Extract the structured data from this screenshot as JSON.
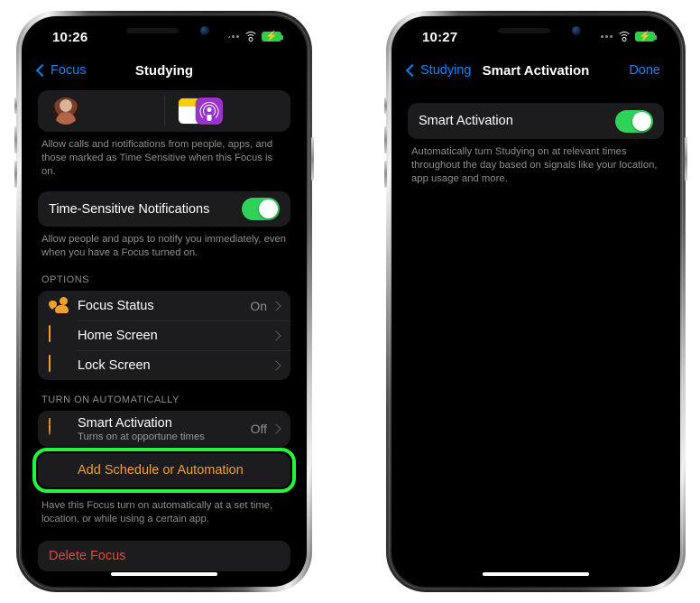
{
  "left_phone": {
    "status_bar": {
      "time": "10:26",
      "wifi_icon": "wifi-icon",
      "battery_icon": "battery-charging-icon",
      "signal_icon": "signal-dots-icon"
    },
    "nav": {
      "back_label": "Focus",
      "title": "Studying",
      "back_icon": "chevron-left-icon"
    },
    "allowed_apps": {
      "avatar_name": "person-avatar",
      "app_icons": [
        "notes-app-icon",
        "podcasts-app-icon"
      ]
    },
    "allowed_footnote": "Allow calls and notifications from people, apps, and those marked as Time Sensitive when this Focus is on.",
    "time_sensitive": {
      "label": "Time-Sensitive Notifications",
      "toggle_state": "on"
    },
    "time_sensitive_footnote": "Allow people and apps to notify you immediately, even when you have a Focus turned on.",
    "options_header": "OPTIONS",
    "options_rows": [
      {
        "label": "Focus Status",
        "value": "On",
        "icon": "focus-status-icon"
      },
      {
        "label": "Home Screen",
        "value": "",
        "icon": "home-screen-icon"
      },
      {
        "label": "Lock Screen",
        "value": "",
        "icon": "lock-screen-icon"
      }
    ],
    "auto_header": "TURN ON AUTOMATICALLY",
    "smart_activation": {
      "label": "Smart Activation",
      "sublabel": "Turns on at opportune times",
      "value": "Off",
      "icon": "power-icon"
    },
    "add_schedule": {
      "label": "Add Schedule or Automation",
      "icon": "plus-circle-icon",
      "highlighted": true
    },
    "add_schedule_footnote": "Have this Focus turn on automatically at a set time, location, or while using a certain app.",
    "delete_focus": {
      "label": "Delete Focus"
    }
  },
  "right_phone": {
    "status_bar": {
      "time": "10:27",
      "wifi_icon": "wifi-icon",
      "battery_icon": "battery-charging-icon",
      "signal_icon": "signal-dots-icon"
    },
    "nav": {
      "back_label": "Studying",
      "title": "Smart Activation",
      "done_label": "Done",
      "back_icon": "chevron-left-icon"
    },
    "smart_activation": {
      "label": "Smart Activation",
      "toggle_state": "on"
    },
    "footnote": "Automatically turn Studying on at relevant times throughout the day based on signals like your location, app usage and more."
  },
  "colors": {
    "accent_blue": "#0a84ff",
    "toggle_green": "#30d158",
    "highlight_green": "#22f53b",
    "orange": "#f0a030",
    "destructive_red": "#e0493c",
    "card_bg": "#1c1c1e",
    "secondary_text": "#8e8e93"
  }
}
